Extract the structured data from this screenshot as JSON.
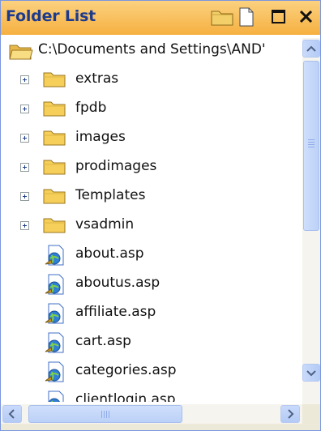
{
  "title_bar": {
    "title": "Folder List",
    "buttons": [
      {
        "name": "new-folder-button",
        "icon": "folder-icon"
      },
      {
        "name": "new-page-button",
        "icon": "page-icon"
      },
      {
        "name": "maximize-button",
        "icon": "maximize-icon"
      },
      {
        "name": "close-button",
        "icon": "close-icon"
      }
    ]
  },
  "root": {
    "label": "C:\\Documents and Settings\\AND'",
    "icon": "open-folder-icon"
  },
  "tree": {
    "items": [
      {
        "label": "extras",
        "type": "folder",
        "expander": true
      },
      {
        "label": "fpdb",
        "type": "folder",
        "expander": true
      },
      {
        "label": "images",
        "type": "folder",
        "expander": true
      },
      {
        "label": "prodimages",
        "type": "folder",
        "expander": true
      },
      {
        "label": "Templates",
        "type": "folder",
        "expander": true
      },
      {
        "label": "vsadmin",
        "type": "folder",
        "expander": true
      },
      {
        "label": "about.asp",
        "type": "file",
        "expander": false
      },
      {
        "label": "aboutus.asp",
        "type": "file",
        "expander": false
      },
      {
        "label": "affiliate.asp",
        "type": "file",
        "expander": false
      },
      {
        "label": "cart.asp",
        "type": "file",
        "expander": false
      },
      {
        "label": "categories.asp",
        "type": "file",
        "expander": false
      },
      {
        "label": "clientlogin.asp",
        "type": "file",
        "expander": false
      }
    ]
  },
  "colors": {
    "title_text": "#1d3b8e",
    "title_bg": "#f6b041",
    "folder": "#f5cf5a",
    "scrollbar": "#bcd1f7"
  }
}
